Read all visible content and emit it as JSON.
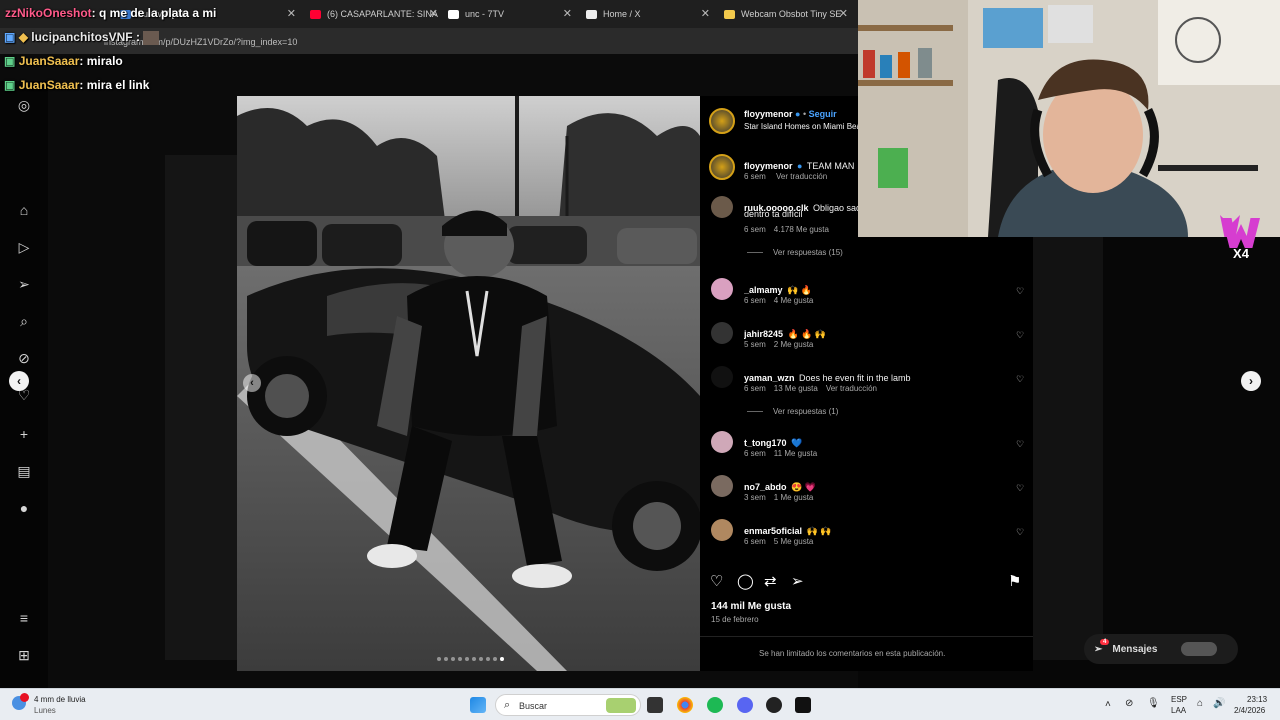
{
  "browser": {
    "tabs": [
      {
        "label": "Survival [Mu",
        "color": "#3a7bd5"
      },
      {
        "label": "(6) CASAPARLANTE: SINA",
        "color": "#ff0033"
      },
      {
        "label": "unc - 7TV",
        "color": "#ffffff"
      },
      {
        "label": "Home / X",
        "color": "#ffffff"
      },
      {
        "label": "Webcam Obsbot Tiny SE",
        "color": "#f2c94c"
      }
    ],
    "url": "instagram.com/p/DUzHZ1VDrZo/?img_index=10"
  },
  "chat": [
    {
      "user": "zzNikoOneshot",
      "message": ": q me de la plata a mi",
      "user_color": "#ff5a8a"
    },
    {
      "user": "lucipanchitosVNF",
      "message": ":",
      "user_color": "#e8e8e8"
    },
    {
      "user": "JuanSaaar",
      "message": ": miralo",
      "user_color": "#f0c050"
    },
    {
      "user": "JuanSaaar",
      "message": ": mira el link",
      "user_color": "#f0c050"
    }
  ],
  "post": {
    "author": "floyymenor",
    "follow": "Seguir",
    "location": "Star Island Homes on Miami Beac",
    "caption_author": "floyymenor",
    "caption_text": "TEAM MAN",
    "caption_time": "6 sem",
    "caption_translate": "Ver traducción",
    "likes": "144 mil Me gusta",
    "date": "15 de febrero",
    "limited_note": "Se han limitado los comentarios en esta publicación."
  },
  "comments": [
    {
      "user": "ruuk.ooooo.clk",
      "text": "Obligao sac",
      "text2": "dentro ta difícil",
      "time": "6 sem",
      "likes": "4.178 Me gusta",
      "extra": "",
      "replies": "Ver respuestas (15)"
    },
    {
      "user": "_almamy",
      "text": "🙌 🔥",
      "time": "6 sem",
      "likes": "4 Me gusta",
      "extra": ""
    },
    {
      "user": "jahir8245",
      "text": "🔥 🔥 🙌",
      "time": "5 sem",
      "likes": "2 Me gusta",
      "extra": ""
    },
    {
      "user": "yaman_wzn",
      "text": "Does he even fit in the lamb",
      "time": "6 sem",
      "likes": "13 Me gusta",
      "extra": "Ver traducción",
      "replies": "Ver respuestas (1)"
    },
    {
      "user": "t_tong170",
      "text": "💙",
      "time": "6 sem",
      "likes": "11 Me gusta",
      "extra": ""
    },
    {
      "user": "no7_abdo",
      "text": "😍 💗",
      "time": "3 sem",
      "likes": "1 Me gusta",
      "extra": ""
    },
    {
      "user": "enmar5oficial",
      "text": "🙌 🙌",
      "time": "6 sem",
      "likes": "5 Me gusta",
      "extra": ""
    }
  ],
  "dm": {
    "label": "Mensajes",
    "badge": "4"
  },
  "taskbar": {
    "weather": "4 mm de lluvia",
    "weather_day": "Lunes",
    "search": "Buscar",
    "lang1": "ESP",
    "lang2": "LAA",
    "time": "23:13",
    "date": "2/4/2026"
  },
  "overlay_badge": "X4",
  "carousel": {
    "dots": 10,
    "active": 9
  }
}
